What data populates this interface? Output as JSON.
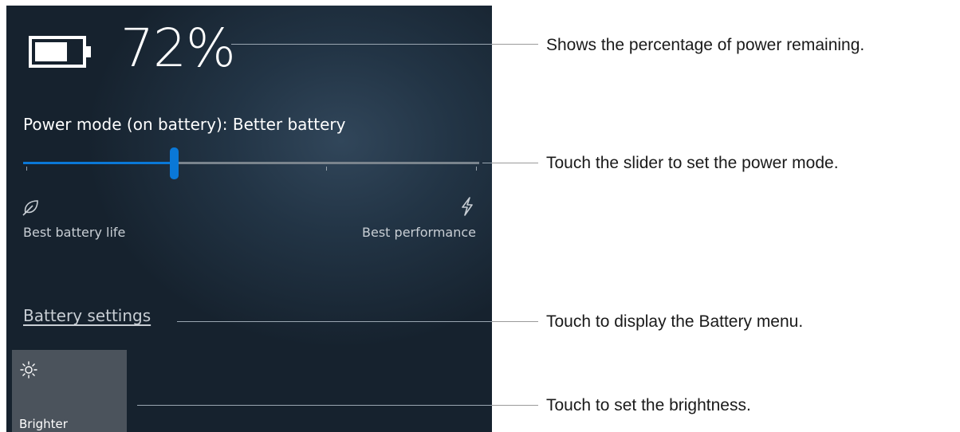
{
  "battery": {
    "percent_label": "72%",
    "level": 0.72,
    "icon": "battery-icon"
  },
  "power_mode": {
    "label": "Power mode (on battery): Better battery",
    "slider_value": 0.33,
    "stops": 4,
    "accent_color": "#0a78d7",
    "left_label": "Best battery life",
    "left_icon": "leaf-icon",
    "right_label": "Best performance",
    "right_icon": "lightning-bolt-icon"
  },
  "battery_settings": {
    "link_text": "Battery settings"
  },
  "brightness": {
    "label": "Brighter",
    "icon": "sun-icon"
  },
  "callouts": {
    "battery": "Shows the percentage of power remaining.",
    "slider": "Touch the slider to set the power mode.",
    "settings": "Touch to display the Battery menu.",
    "brightness": "Touch to set the brightness."
  }
}
